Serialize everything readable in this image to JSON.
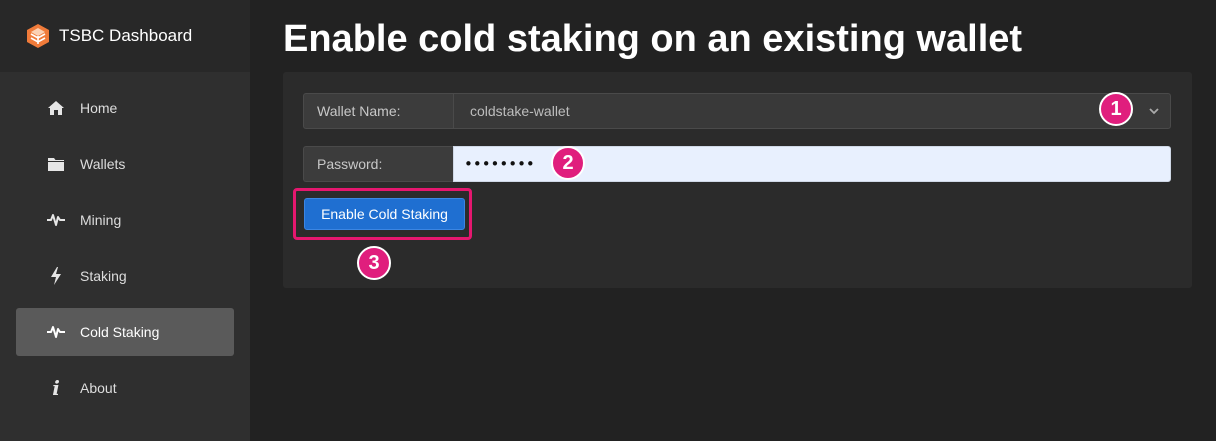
{
  "app": {
    "brand": "TSBC Dashboard"
  },
  "sidebar": {
    "items": [
      {
        "label": "Home",
        "icon": "home-icon",
        "active": false
      },
      {
        "label": "Wallets",
        "icon": "folder-icon",
        "active": false
      },
      {
        "label": "Mining",
        "icon": "pulse-icon",
        "active": false
      },
      {
        "label": "Staking",
        "icon": "bolt-icon",
        "active": false
      },
      {
        "label": "Cold Staking",
        "icon": "pulse-icon",
        "active": true
      },
      {
        "label": "About",
        "icon": "info-icon",
        "active": false
      }
    ]
  },
  "main": {
    "title": "Enable cold staking on an existing wallet",
    "wallet": {
      "label": "Wallet Name:",
      "value": "coldstake-wallet"
    },
    "password": {
      "label": "Password:",
      "value": "••••••••"
    },
    "button_label": "Enable Cold Staking"
  },
  "annotations": {
    "step1": "1",
    "step2": "2",
    "step3": "3"
  },
  "colors": {
    "accent": "#1f6fd1",
    "highlight": "#e5176f",
    "badge": "#e01e7d",
    "sidebar_active": "#5a5a5a",
    "background": "#222222"
  }
}
